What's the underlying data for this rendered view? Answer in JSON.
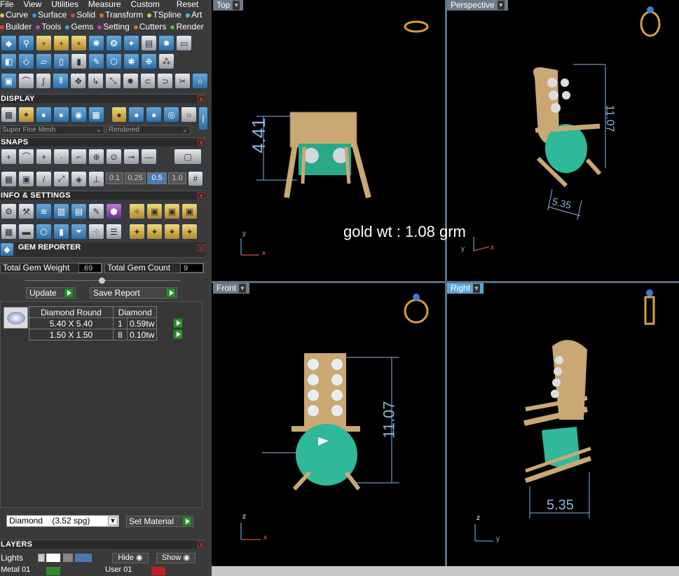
{
  "menu": [
    "File",
    "View",
    "Utilities",
    "Measure",
    "Custom",
    "Reset"
  ],
  "tabs1": [
    {
      "label": "Curve",
      "color": "#e0c040"
    },
    {
      "label": "Surface",
      "color": "#4090e0"
    },
    {
      "label": "Solid",
      "color": "#e04040"
    },
    {
      "label": "Transform",
      "color": "#e07020"
    },
    {
      "label": "TSpline",
      "color": "#e0c040"
    },
    {
      "label": "Art",
      "color": "#40c0e0"
    }
  ],
  "tabs2": [
    {
      "label": "Builder",
      "color": "#e04040"
    },
    {
      "label": "Tools",
      "color": "#c040c0"
    },
    {
      "label": "Gems",
      "color": "#40a0e0"
    },
    {
      "label": "Setting",
      "color": "#c040c0"
    },
    {
      "label": "Cutters",
      "color": "#e07020"
    },
    {
      "label": "Render",
      "color": "#40c040"
    }
  ],
  "display": {
    "title": "DISPLAY",
    "mesh": "Super Fine Mesh",
    "mode": "Rendered"
  },
  "snaps": {
    "title": "SNAPS",
    "values": [
      "0.1",
      "0.25",
      "0.5",
      "1.0"
    ],
    "selected": "0.5"
  },
  "info": {
    "title": "INFO & SETTINGS"
  },
  "gem_reporter": {
    "title": "GEM REPORTER",
    "total_weight_label": "Total Gem Weight",
    "total_weight": ".69",
    "total_count_label": "Total Gem Count",
    "total_count": "9",
    "update": "Update",
    "save_report": "Save Report",
    "header": [
      "Diamond Round",
      "Diamond"
    ],
    "rows": [
      {
        "size": "5.40 X 5.40",
        "count": "1",
        "wt": "0.59tw"
      },
      {
        "size": "1.50 X 1.50",
        "count": "8",
        "wt": "0.10tw"
      }
    ]
  },
  "material": {
    "selected": "Diamond    (3.52 spg)",
    "set_label": "Set Material"
  },
  "layers": {
    "title": "LAYERS",
    "rows": [
      {
        "name": "Lights",
        "hide": "Hide",
        "show": "Show"
      },
      {
        "name": "Metal 01",
        "user": "User 01"
      }
    ]
  },
  "views": {
    "top": "Top",
    "perspective": "Perspective",
    "front": "Front",
    "right": "Right"
  },
  "dims": {
    "top": "4.41",
    "persp_h": "11.07",
    "persp_w": "5.35",
    "front_h": "11.07",
    "right_w": "5.35"
  },
  "annotation": "gold wt : 1.08 grm",
  "axes": {
    "top": [
      "y",
      "x"
    ],
    "persp": [
      "y",
      "x"
    ],
    "front": [
      "z",
      "x"
    ],
    "right": [
      "z",
      "y"
    ]
  }
}
